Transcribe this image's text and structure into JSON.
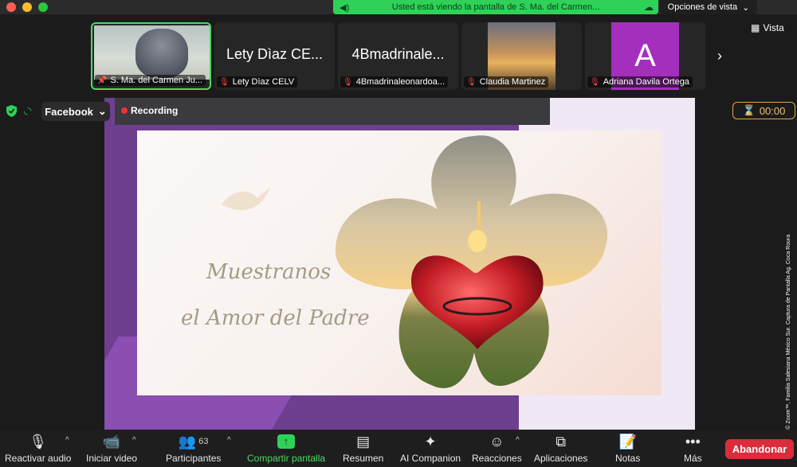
{
  "banner": {
    "share_text": "Usted está viendo la pantalla de S. Ma. del Carmen...",
    "view_options": "Opciones de vista"
  },
  "view_button": "Vista",
  "participants": [
    {
      "big": "",
      "label": "S. Ma. del Carmen Ju...",
      "type": "photo-man",
      "active": true,
      "muted": false
    },
    {
      "big": "Lety Dìaz CE...",
      "label": "Lety Dìaz CELV",
      "type": "text",
      "active": false,
      "muted": true
    },
    {
      "big": "4Bmadrinale...",
      "label": "4Bmadrinaleonardoa...",
      "type": "text",
      "active": false,
      "muted": true
    },
    {
      "big": "",
      "label": "Claudia Martinez",
      "type": "photo-sky",
      "active": false,
      "muted": true
    },
    {
      "big": "A",
      "label": "Adriana Davila Ortega",
      "type": "avatar",
      "active": false,
      "muted": true
    }
  ],
  "stream": {
    "facebook_label": "Facebook",
    "recording_label": "Recording",
    "timer": "00:00"
  },
  "slide": {
    "line1": "Muestranos",
    "line2": "el Amor del Padre"
  },
  "credit": "Cortesía © Zoom™, Familia Salesiana México Sur. Captura de Pantalla Ag. Coca Roura",
  "toolbar": {
    "audio": "Reactivar audio",
    "video": "Iniciar video",
    "participants": "Participantes",
    "participants_count": "63",
    "share": "Compartir pantalla",
    "summary": "Resumen",
    "companion": "AI Companion",
    "reactions": "Reacciones",
    "apps": "Aplicaciones",
    "notes": "Notas",
    "more": "Más",
    "leave": "Abandonar"
  },
  "colors": {
    "share_banner": "#2fd158",
    "active_border": "#4cd964",
    "leave": "#d92d3c",
    "timer": "#e3a84b",
    "avatar": "#a42fbd"
  }
}
